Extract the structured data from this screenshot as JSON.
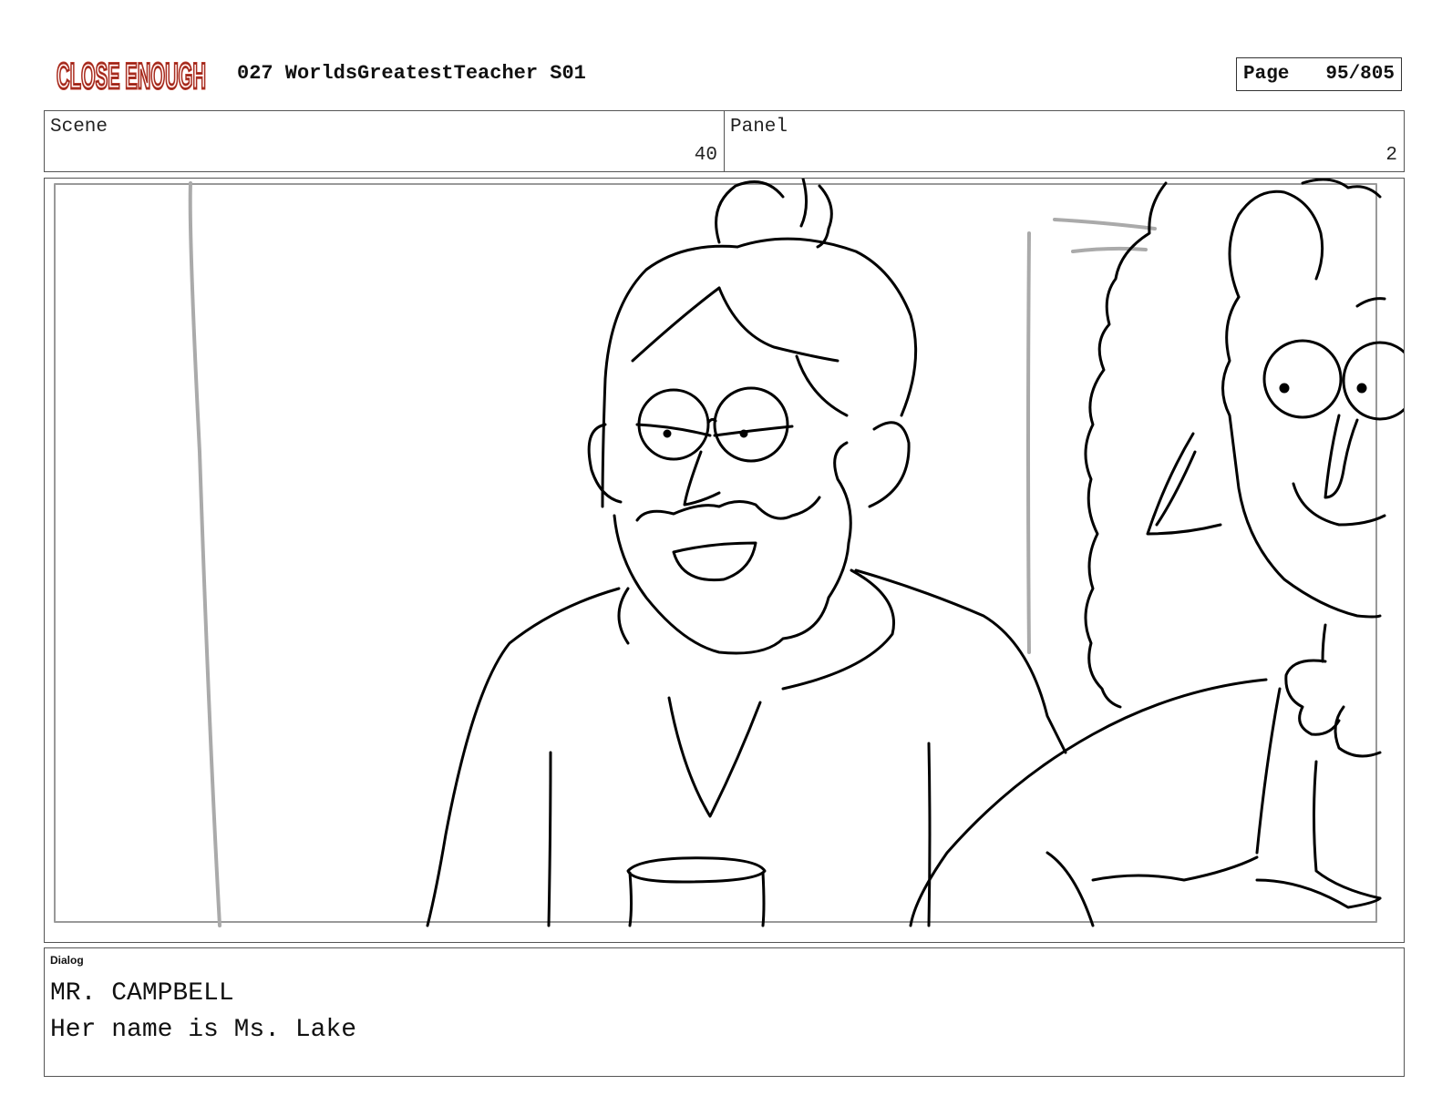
{
  "header": {
    "logo_text": "CLOSE ENOUGH",
    "title": "027 WorldsGreatestTeacher S01",
    "page_label": "Page",
    "page_value": "95/805"
  },
  "meta": {
    "scene_label": "Scene",
    "scene_value": "40",
    "panel_label": "Panel",
    "panel_value": "2"
  },
  "dialog": {
    "label": "Dialog",
    "character": "MR. CAMPBELL",
    "line": "Her name is Ms. Lake"
  },
  "colors": {
    "logo_red": "#c0392b",
    "frame_gray": "#555555",
    "sketch_ink": "#000000",
    "guide_gray": "#aaaaaa"
  }
}
